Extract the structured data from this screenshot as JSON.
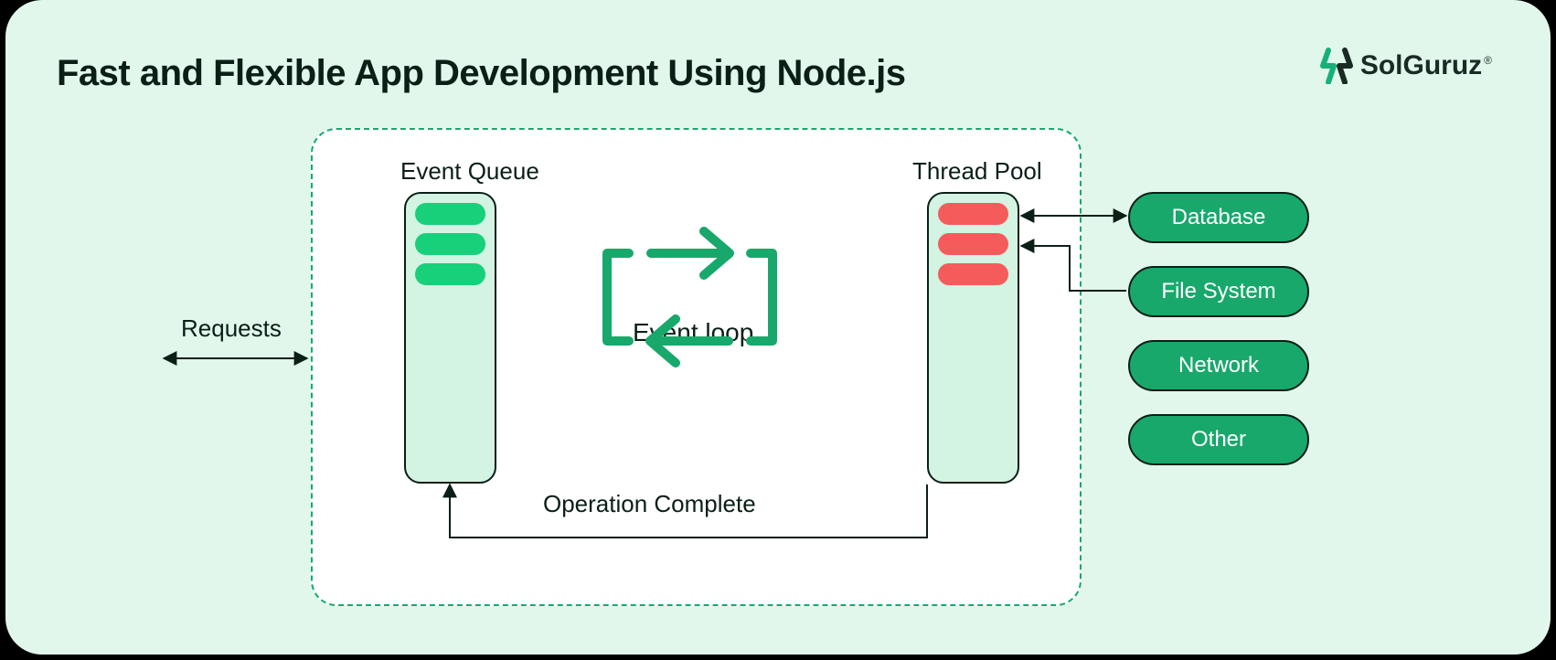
{
  "title": "Fast and Flexible App Development Using Node.js",
  "brand": {
    "name": "SolGuruz",
    "trademark": "®"
  },
  "labels": {
    "requests": "Requests",
    "event_queue": "Event Queue",
    "thread_pool": "Thread Pool",
    "event_loop": "Event loop",
    "operation_complete": "Operation Complete"
  },
  "externals": {
    "database": "Database",
    "file_system": "File System",
    "network": "Network",
    "other": "Other"
  },
  "colors": {
    "accent": "#18a86b",
    "queue_item": "#17d07a",
    "thread_item": "#f65b5b",
    "panel": "#e1f7ec"
  }
}
